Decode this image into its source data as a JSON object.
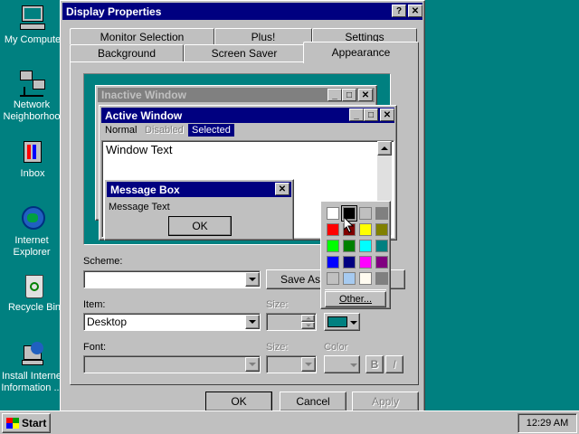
{
  "desktop": {
    "icons": [
      {
        "label": "My Compute"
      },
      {
        "label": "Network Neighborhoo"
      },
      {
        "label": "Inbox"
      },
      {
        "label": "Internet Explorer"
      },
      {
        "label": "Recycle Bin"
      },
      {
        "label": "Install Interne Information ..."
      }
    ]
  },
  "dialog": {
    "title": "Display Properties",
    "help_glyph": "?",
    "close_glyph": "✕",
    "tabs_row1": [
      "Monitor Selection",
      "Plus!",
      "Settings"
    ],
    "tabs_row2": [
      "Background",
      "Screen Saver",
      "Appearance"
    ],
    "active_tab": "Appearance",
    "preview": {
      "inactive_title": "Inactive Window",
      "active_title": "Active Window",
      "menu": [
        "Normal",
        "Disabled",
        "Selected"
      ],
      "window_text": "Window Text",
      "msgbox_title": "Message Box",
      "msgbox_text": "Message Text",
      "msgbox_ok": "OK"
    },
    "scheme_label": "Scheme:",
    "scheme_value": "",
    "save_as_label": "Save As...",
    "item_label": "Item:",
    "item_value": "Desktop",
    "size_label": "Size:",
    "color_label": "Color",
    "font_label": "Font:",
    "font_size_label": "Size:",
    "font_color_label": "Color",
    "bold_glyph": "B",
    "italic_glyph": "I",
    "ok": "OK",
    "cancel": "Cancel",
    "apply": "Apply"
  },
  "color_picker": {
    "other_label": "Other...",
    "colors": [
      "#ffffff",
      "#000000",
      "#c0c0c0",
      "#808080",
      "#ff0000",
      "#800000",
      "#ffff00",
      "#808000",
      "#00ff00",
      "#008000",
      "#00ffff",
      "#008080",
      "#0000ff",
      "#000080",
      "#ff00ff",
      "#800080",
      "#c0c0c0",
      "#a6caf0",
      "#fffbf0",
      "#808080"
    ],
    "selected_color": "#008080"
  },
  "taskbar": {
    "start_label": "Start",
    "clock": "12:29 AM"
  }
}
